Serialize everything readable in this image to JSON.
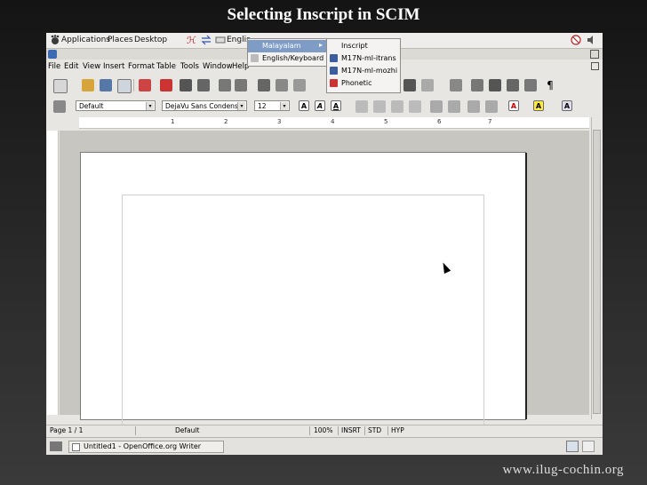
{
  "slide": {
    "title": "Selecting Inscript in SCIM",
    "footer": "www.ilug-cochin.org"
  },
  "gnome_panel": {
    "applications": "Applications",
    "places": "Places",
    "desktop": "Desktop",
    "input_method": "Englis"
  },
  "im_menu": {
    "items": [
      "Malayalam",
      "English/Keyboard"
    ],
    "submenu": [
      "Inscript",
      "M17N-ml-itrans",
      "M17N-ml-mozhi",
      "Phonetic"
    ]
  },
  "menubar": [
    "File",
    "Edit",
    "View",
    "Insert",
    "Format",
    "Table",
    "Tools",
    "Window",
    "Help"
  ],
  "formatting": {
    "style": "Default",
    "font": "DejaVu Sans Condense",
    "size": "12"
  },
  "ruler_marks": [
    "1",
    "2",
    "3",
    "4",
    "5",
    "6",
    "7"
  ],
  "status": {
    "page": "Page 1 / 1",
    "style": "Default",
    "zoom": "100%",
    "insert": "INSRT",
    "std": "STD",
    "hyp": "HYP"
  },
  "taskbar": {
    "window": "Untitled1 - OpenOffice.org Writer"
  },
  "colors": {
    "highlight": "#7f9cc6",
    "background": "#1c1c1c"
  }
}
